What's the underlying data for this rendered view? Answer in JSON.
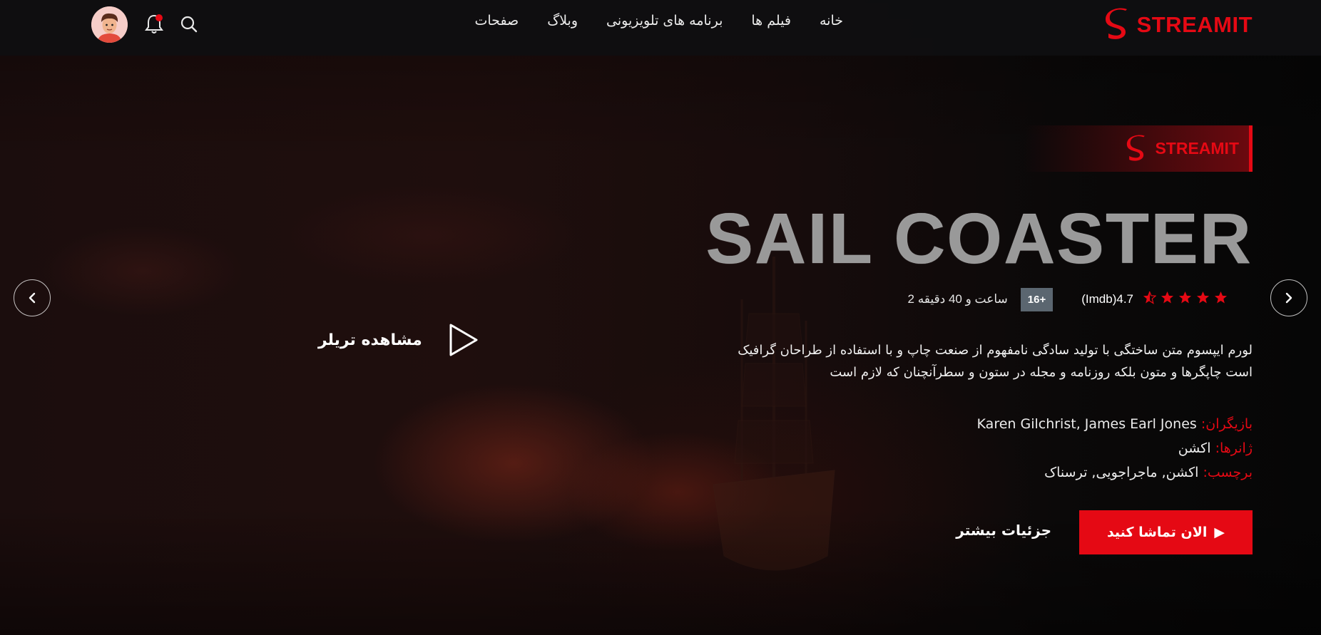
{
  "brand": {
    "name": "STREAMIT",
    "accent": "#e50914"
  },
  "nav": [
    {
      "label": "خانه"
    },
    {
      "label": "فیلم ها"
    },
    {
      "label": "برنامه های تلویزیونی"
    },
    {
      "label": "وبلاگ"
    },
    {
      "label": "صفحات"
    }
  ],
  "header_icons": [
    "search-icon",
    "bell-icon",
    "avatar"
  ],
  "hero": {
    "badge": "STREAMIT",
    "title": "SAIL COASTER",
    "rating_stars": 4.5,
    "rating_text": "(Imdb)4.7",
    "age": "16+",
    "duration": "2 ساعت و 40 دقیقه",
    "description": "لورم ایپسوم متن ساختگی با تولید سادگی نامفهوم از صنعت چاپ و با استفاده از طراحان گرافیک است چاپگرها و متون بلکه روزنامه و مجله در ستون و سطرآنچنان که لازم است",
    "cast_label": "بازیگران:",
    "cast_value": "Karen Gilchrist, James Earl Jones",
    "genre_label": "ژانرها:",
    "genre_value": "اکشن",
    "tags_label": "برچسب:",
    "tags_value": "اکشن, ماجراجویی, ترسناک",
    "watch_label": "الان تماشا کنید",
    "more_label": "جزئیات بیشتر",
    "trailer_label": "مشاهده تریلر"
  },
  "colors": {
    "accent": "#e50914",
    "age_badge": "#5b6670"
  }
}
